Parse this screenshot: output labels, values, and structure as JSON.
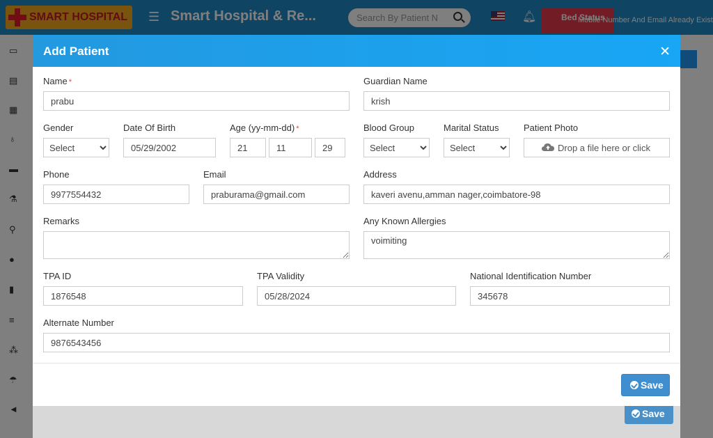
{
  "app": {
    "logo_text": "SMART HOSPITAL",
    "title": "Smart Hospital & Re...",
    "search_placeholder": "Search By Patient N",
    "bed_status": "Bed Status",
    "notice": "Mobile Number And Email Already Exist"
  },
  "modal": {
    "title": "Add Patient",
    "save_label": "Save",
    "bg_save_label": "Save"
  },
  "form": {
    "name": {
      "label": "Name",
      "value": "prabu"
    },
    "guardian_name": {
      "label": "Guardian Name",
      "value": "krish"
    },
    "gender": {
      "label": "Gender",
      "value": "Select"
    },
    "date_of_birth": {
      "label": "Date Of Birth",
      "value": "05/29/2002"
    },
    "age": {
      "label": "Age (yy-mm-dd)",
      "years": "21",
      "months": "11",
      "days": "29"
    },
    "blood_group": {
      "label": "Blood Group",
      "value": "Select"
    },
    "marital_status": {
      "label": "Marital Status",
      "value": "Select"
    },
    "patient_photo": {
      "label": "Patient Photo",
      "dropzone": "Drop a file here or click"
    },
    "phone": {
      "label": "Phone",
      "value": "9977554432"
    },
    "email": {
      "label": "Email",
      "value": "praburama@gmail.com"
    },
    "address": {
      "label": "Address",
      "value": "kaveri avenu,amman nager,coimbatore-98"
    },
    "remarks": {
      "label": "Remarks",
      "value": ""
    },
    "allergies": {
      "label": "Any Known Allergies",
      "value": "voimiting"
    },
    "tpa_id": {
      "label": "TPA ID",
      "value": "1876548"
    },
    "tpa_validity": {
      "label": "TPA Validity",
      "value": "05/28/2024"
    },
    "national_id": {
      "label": "National Identification Number",
      "value": "345678"
    },
    "alternate_number": {
      "label": "Alternate Number",
      "value": "9876543456"
    }
  },
  "colors": {
    "header": "#1e88c7",
    "modal_header": "#18a6f5",
    "save_button": "#3f8fd0",
    "required": "#e0473b"
  }
}
